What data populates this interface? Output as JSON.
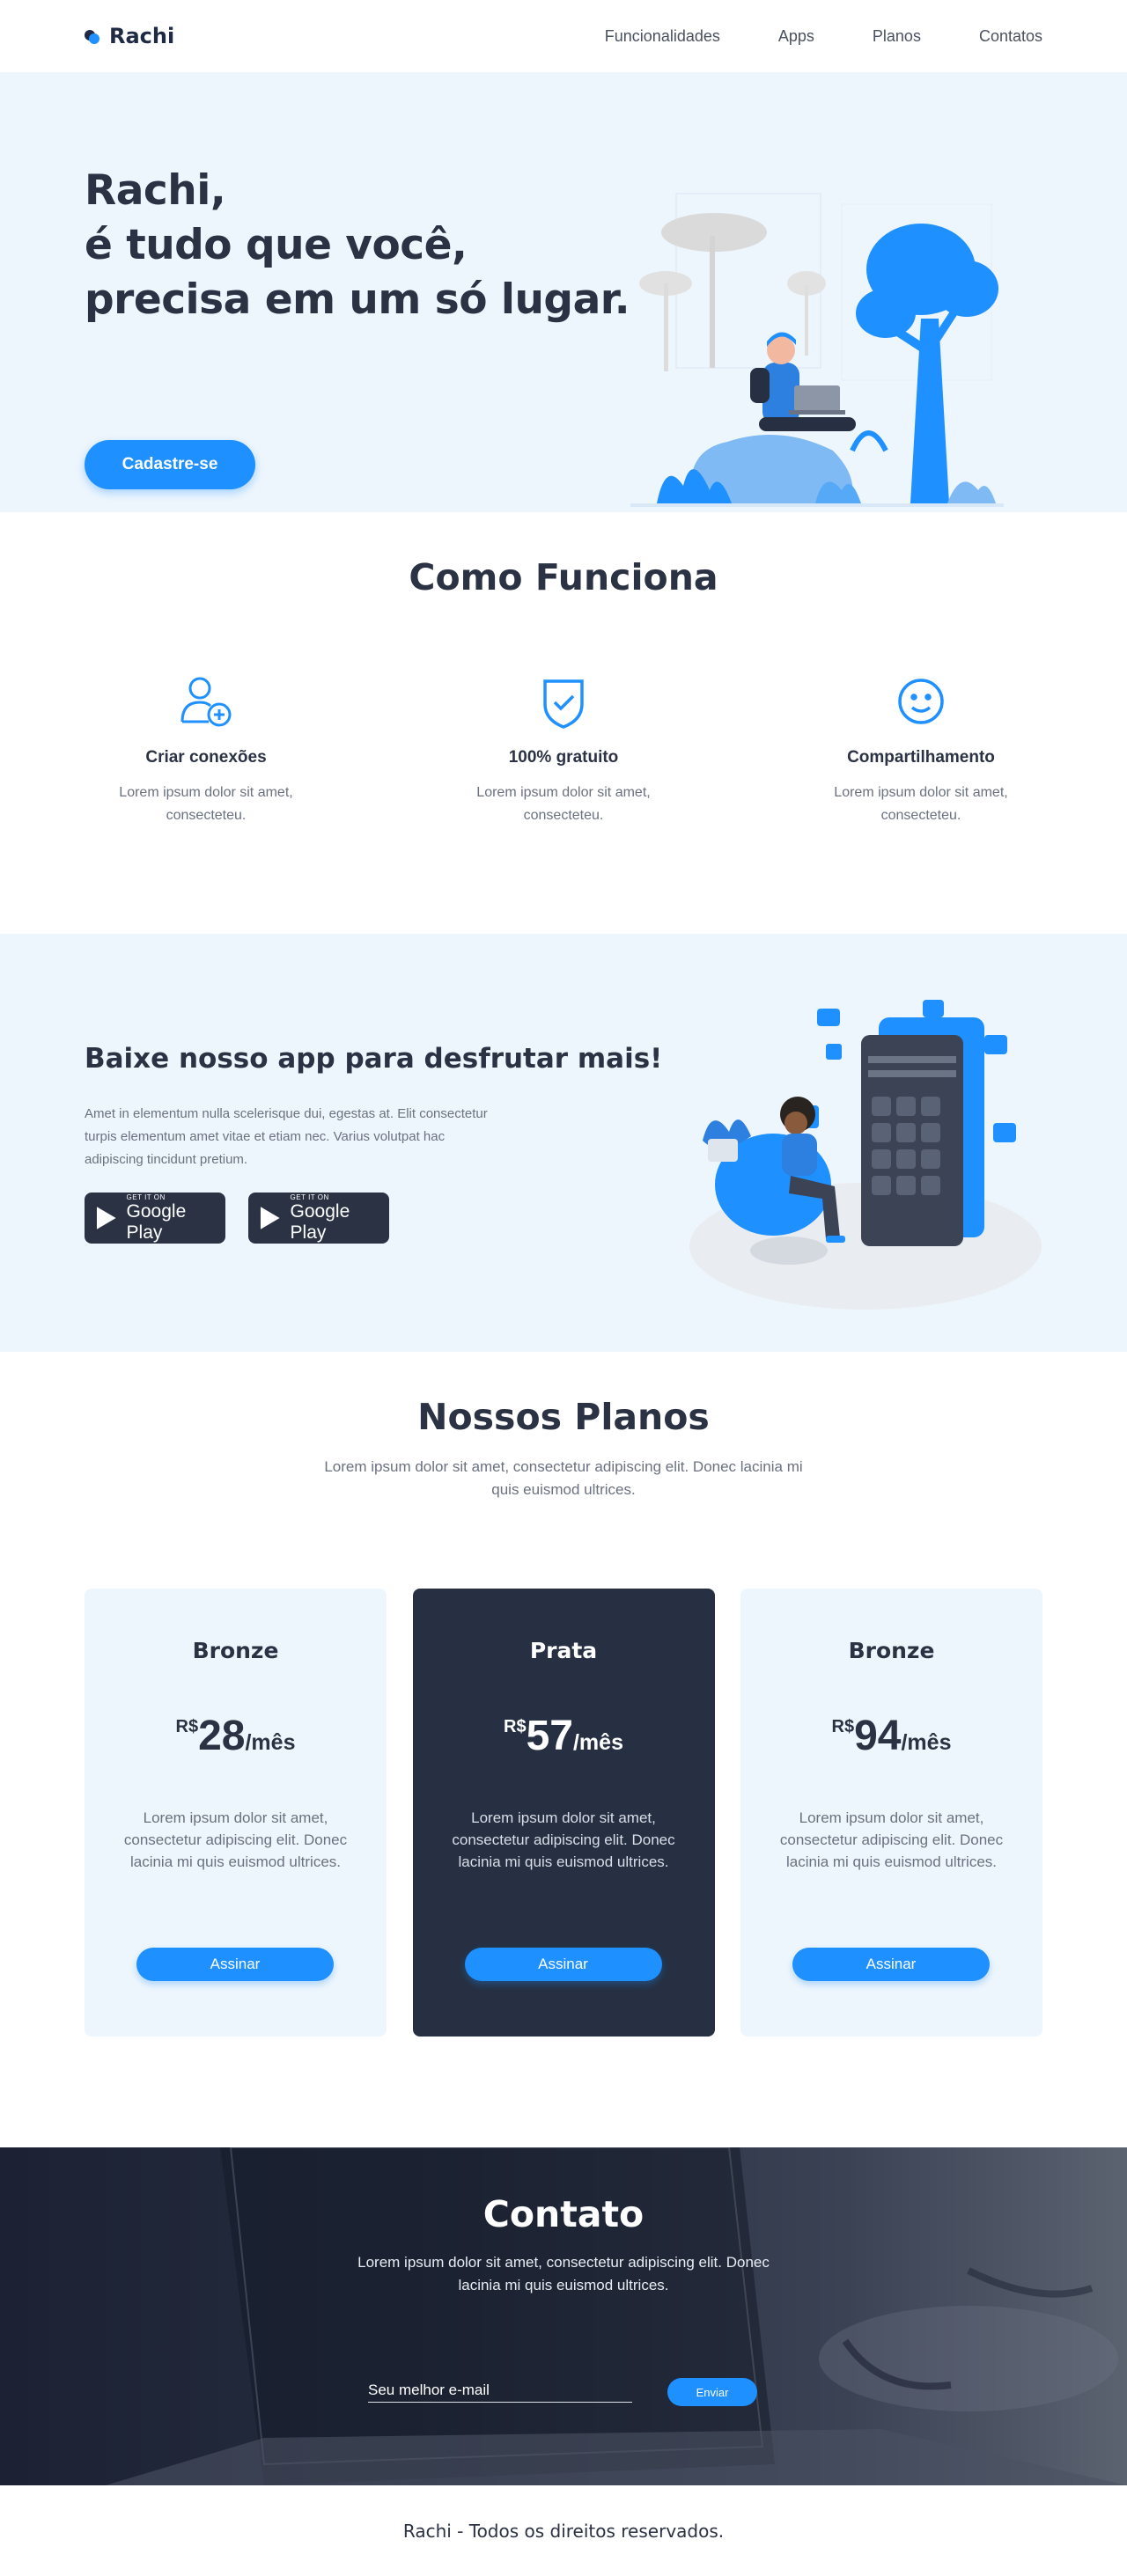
{
  "header": {
    "logo_text": "Rachi",
    "nav": [
      "Funcionalidades",
      "Apps",
      "Planos",
      "Contatos"
    ]
  },
  "hero": {
    "title": "Rachi,\né tudo que você,\nprecisa em um só lugar.",
    "cta_label": "Cadastre-se"
  },
  "how": {
    "title": "Como Funciona",
    "features": [
      {
        "icon": "add-user-icon",
        "title": "Criar conexões",
        "text": "Lorem ipsum dolor sit amet, consecteteu."
      },
      {
        "icon": "shield-check-icon",
        "title": "100% gratuito",
        "text": "Lorem ipsum dolor sit amet, consecteteu."
      },
      {
        "icon": "smile-icon",
        "title": "Compartilhamento",
        "text": "Lorem ipsum dolor sit amet, consecteteu."
      }
    ]
  },
  "app": {
    "title": "Baixe nosso app para desfrutar mais!",
    "text": "Amet in elementum nulla scelerisque dui, egestas at. Elit consectetur turpis elementum amet vitae et etiam nec. Varius volutpat hac adipiscing tincidunt pretium.",
    "stores": [
      {
        "small": "GET IT ON",
        "big": "Google Play"
      },
      {
        "small": "GET IT ON",
        "big": "Google Play"
      }
    ]
  },
  "plans": {
    "title": "Nossos Planos",
    "subtitle": "Lorem ipsum dolor sit amet, consectetur adipiscing elit. Donec lacinia mi quis euismod ultrices.",
    "cards": [
      {
        "name": "Bronze",
        "currency": "R$",
        "amount": "28",
        "period": "/mês",
        "text": "Lorem ipsum dolor sit amet, consectetur adipiscing elit. Donec lacinia mi quis euismod ultrices.",
        "button": "Assinar"
      },
      {
        "name": "Prata",
        "currency": "R$",
        "amount": "57",
        "period": "/mês",
        "text": "Lorem ipsum dolor sit amet, consectetur adipiscing elit. Donec lacinia mi quis euismod ultrices.",
        "button": "Assinar"
      },
      {
        "name": "Bronze",
        "currency": "R$",
        "amount": "94",
        "period": "/mês",
        "text": "Lorem ipsum dolor sit amet, consectetur adipiscing elit. Donec lacinia mi quis euismod ultrices.",
        "button": "Assinar"
      }
    ]
  },
  "contact": {
    "title": "Contato",
    "subtitle": "Lorem ipsum dolor sit amet, consectetur adipiscing elit. Donec lacinia mi quis euismod ultrices.",
    "email_placeholder": "Seu melhor e-mail",
    "send_label": "Enviar"
  },
  "footer": {
    "text": "Rachi - Todos os direitos reservados."
  },
  "colors": {
    "accent": "#1e90ff",
    "dark": "#263042",
    "light_bg": "#eef6fd"
  }
}
